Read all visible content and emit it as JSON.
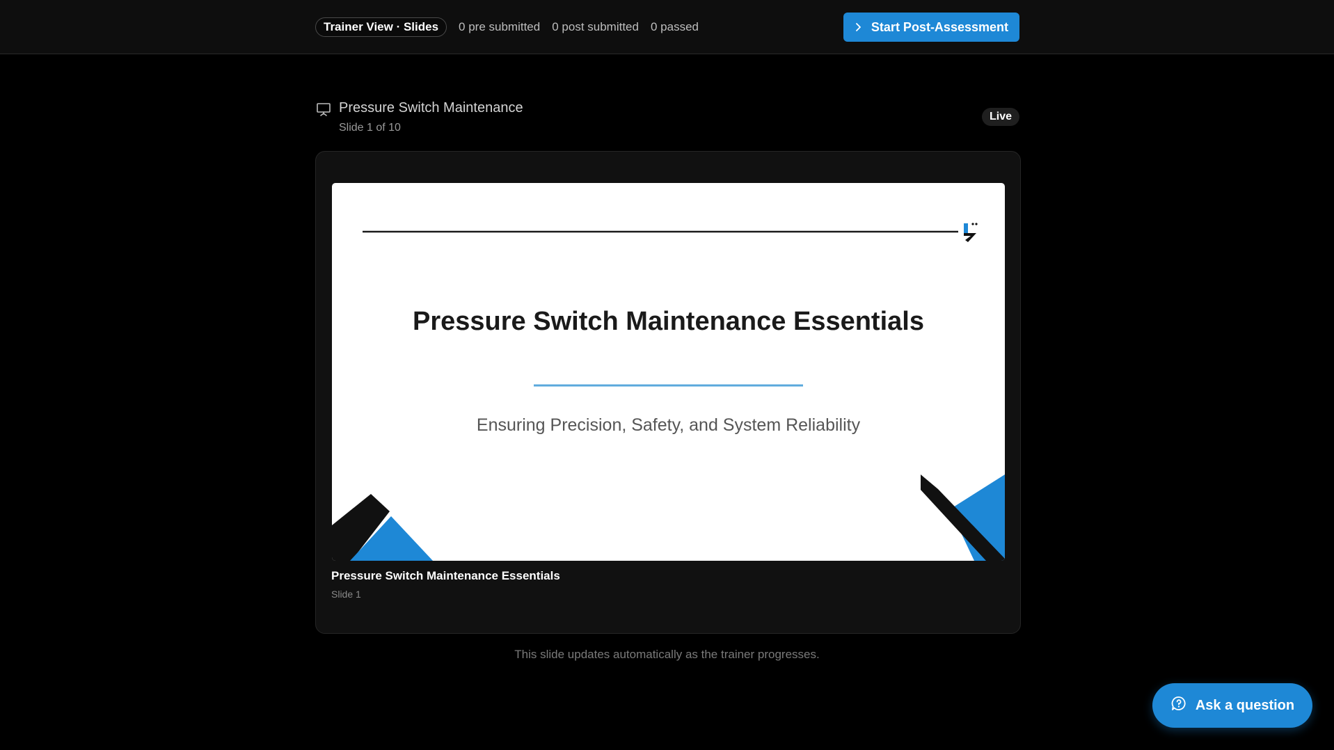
{
  "topbar": {
    "mode_label": "Trainer View · Slides",
    "stats": {
      "pre": "0 pre submitted",
      "post": "0 post submitted",
      "passed": "0 passed"
    },
    "start_button_label": "Start Post-Assessment"
  },
  "presentation": {
    "title": "Pressure Switch Maintenance",
    "slide_counter": "Slide 1 of 10",
    "status_badge": "Live"
  },
  "slide": {
    "title": "Pressure Switch Maintenance Essentials",
    "subtitle": "Ensuring Precision, Safety, and System Reliability",
    "caption_title": "Pressure Switch Maintenance Essentials",
    "caption_sub": "Slide 1"
  },
  "footnote": "This slide updates automatically as the trainer progresses.",
  "help_button_label": "Ask a question",
  "colors": {
    "accent": "#1e88d6",
    "background": "#000000",
    "card": "#111111",
    "slide_accent_line": "#5aa8dc"
  },
  "icons": {
    "start": "chevron-right-icon",
    "presentation": "presentation-board-icon",
    "help": "help-bubble-icon",
    "brand": "brand-logo-icon"
  }
}
